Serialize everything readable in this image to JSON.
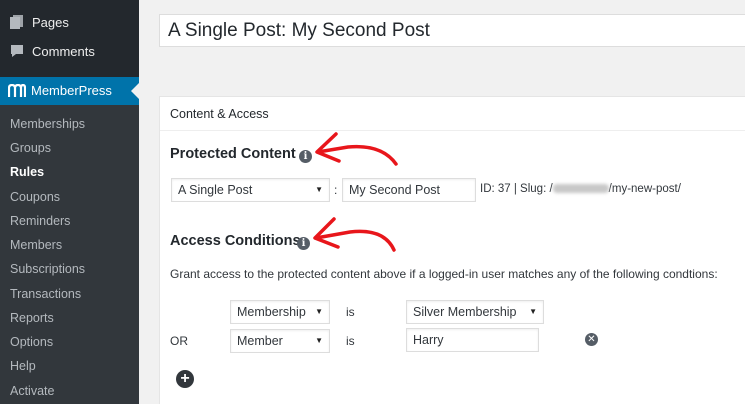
{
  "sidebar": {
    "top_items": [
      {
        "label": "Pages",
        "icon": "pages-icon"
      },
      {
        "label": "Comments",
        "icon": "comments-icon"
      }
    ],
    "active_plugin": {
      "label": "MemberPress",
      "icon": "memberpress-logo-icon"
    },
    "submenu": [
      {
        "label": "Memberships"
      },
      {
        "label": "Groups"
      },
      {
        "label": "Rules",
        "current": true
      },
      {
        "label": "Coupons"
      },
      {
        "label": "Reminders"
      },
      {
        "label": "Members"
      },
      {
        "label": "Subscriptions"
      },
      {
        "label": "Transactions"
      },
      {
        "label": "Reports"
      },
      {
        "label": "Options"
      },
      {
        "label": "Help"
      },
      {
        "label": "Activate"
      }
    ]
  },
  "title_field": {
    "value": "A Single Post: My Second Post"
  },
  "panel": {
    "header": "Content & Access",
    "protected_content": {
      "title": "Protected Content",
      "type_select": "A Single Post",
      "separator": ":",
      "post_input": "My Second Post",
      "id_text": "ID: 37 | Slug: /",
      "slug_suffix": "/my-new-post/"
    },
    "access_conditions": {
      "title": "Access Conditions",
      "description": "Grant access to the protected content above if a logged-in user matches any of the following condtions:",
      "rows": [
        {
          "prefix": "",
          "type": "Membership",
          "operator": "is",
          "value": "Silver Membership",
          "value_kind": "select"
        },
        {
          "prefix": "OR",
          "type": "Member",
          "operator": "is",
          "value": "Harry",
          "value_kind": "input"
        }
      ]
    }
  },
  "colors": {
    "sidebar_bg": "#23282d",
    "submenu_bg": "#32373c",
    "accent": "#0073aa",
    "annotation_red": "#e8161b"
  }
}
